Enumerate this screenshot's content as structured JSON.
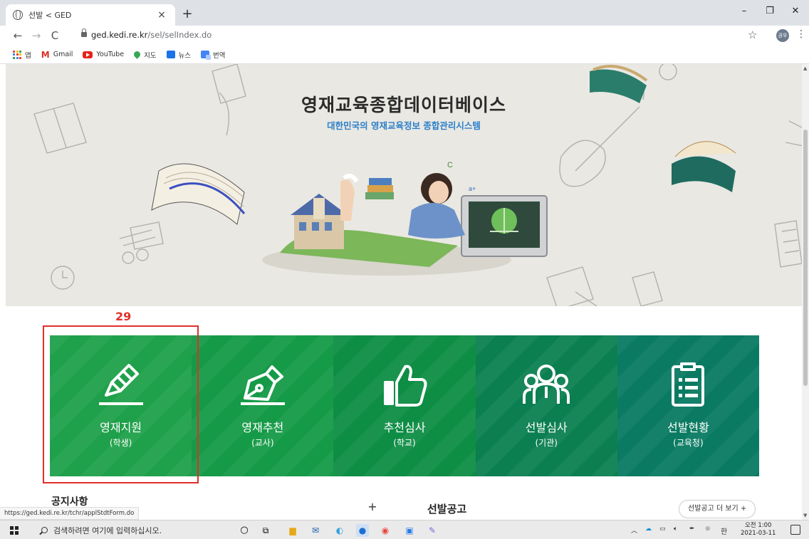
{
  "browser": {
    "tab_title": "선발 < GED",
    "tab_close": "×",
    "new_tab": "+",
    "url_host": "ged.kedi.re.kr",
    "url_path": "/sel/selIndex.do",
    "profile_initials": "권우",
    "window_controls": [
      "–",
      "❐",
      "✕"
    ]
  },
  "bookmarks": [
    {
      "label": "앱",
      "icon": "apps-grid-icon"
    },
    {
      "label": "Gmail",
      "icon": "gmail-icon"
    },
    {
      "label": "YouTube",
      "icon": "youtube-icon"
    },
    {
      "label": "지도",
      "icon": "maps-pin-icon"
    },
    {
      "label": "뉴스",
      "icon": "news-icon"
    },
    {
      "label": "번역",
      "icon": "translate-icon"
    }
  ],
  "hero": {
    "title": "영재교육종합데이터베이스",
    "subtitle": "대한민국의 영재교육정보 종합관리시스템"
  },
  "annotation": {
    "marker_number": "29",
    "color": "#e0302a"
  },
  "menu": [
    {
      "label": "영재지원",
      "sub": "(학생)",
      "icon": "pencil-write-icon",
      "color": "#1fa04a"
    },
    {
      "label": "영재추천",
      "sub": "(교사)",
      "icon": "fountain-pen-icon",
      "color": "#159a47"
    },
    {
      "label": "추천심사",
      "sub": "(학교)",
      "icon": "thumbs-up-icon",
      "color": "#0e8d45"
    },
    {
      "label": "선발심사",
      "sub": "(기관)",
      "icon": "people-group-icon",
      "color": "#0b7f50"
    },
    {
      "label": "선발현황",
      "sub": "(교육청)",
      "icon": "clipboard-list-icon",
      "color": "#0a7a62"
    }
  ],
  "sections": {
    "notice_heading": "공지사항",
    "plus": "+",
    "selection_heading": "선발공고",
    "more_button": "선발공고 더 보기 +"
  },
  "status_url": "https://ged.kedi.re.kr/tchr/applStdtForm.do",
  "taskbar": {
    "search_placeholder": "검색하려면 여기에 입력하십시오.",
    "time": "오전 1:00",
    "date": "2021-03-11",
    "ime": "한"
  }
}
